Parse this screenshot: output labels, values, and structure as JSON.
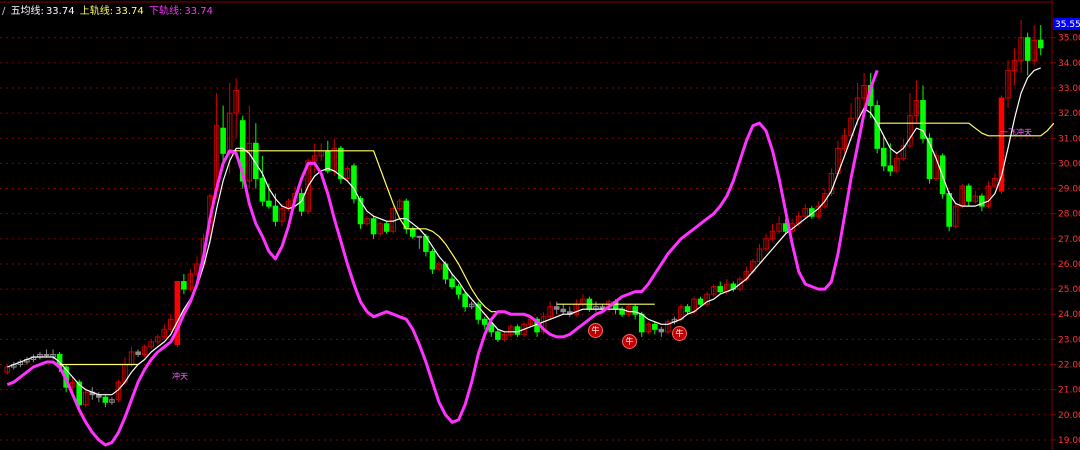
{
  "legend": {
    "prefix": "/",
    "ma_label": "五均线:",
    "ma_value": "33.74",
    "upper_label": "上轨线:",
    "upper_value": "33.74",
    "lower_label": "下轨线:",
    "lower_value": "33.74"
  },
  "price_tag": "35.55",
  "labels": {
    "chongtian": "冲天",
    "yiqichongtian": "一飞冲天",
    "niu": "牛"
  },
  "colors": {
    "up_candle": "#cc0000",
    "down_candle": "#00ff00",
    "doji_candle": "#8c8c8c",
    "limit_up": "#ff0000",
    "ma_line": "#ffffff",
    "upper_band": "#ffff66",
    "lower_band": "#ff33ff",
    "grid": "#800000",
    "axis_text": "#ff3333",
    "price_tag_bg": "#0000ff"
  },
  "chart_data": {
    "type": "candlestick",
    "title": "",
    "y_ticks": [
      19.0,
      20.0,
      21.0,
      22.0,
      23.0,
      24.0,
      25.0,
      26.0,
      27.0,
      28.0,
      29.0,
      30.0,
      31.0,
      32.0,
      33.0,
      34.0,
      35.0
    ],
    "ylim": [
      18.6,
      36.5
    ],
    "grid": true,
    "candles": [
      [
        21.7,
        21.9,
        21.6,
        22.0
      ],
      [
        21.9,
        22.0,
        21.8,
        22.1
      ],
      [
        22.0,
        22.1,
        21.9,
        22.2
      ],
      [
        22.1,
        22.2,
        22.0,
        22.3
      ],
      [
        22.2,
        22.3,
        22.1,
        22.4
      ],
      [
        22.3,
        22.4,
        22.2,
        22.5
      ],
      [
        22.4,
        22.4,
        22.3,
        22.6
      ],
      [
        22.3,
        22.4,
        22.2,
        22.6
      ],
      [
        22.4,
        21.9,
        21.7,
        22.5
      ],
      [
        21.9,
        21.1,
        20.9,
        22.0
      ],
      [
        21.1,
        21.3,
        20.9,
        21.5
      ],
      [
        21.3,
        20.4,
        20.2,
        21.4
      ],
      [
        20.4,
        20.9,
        20.3,
        21.0
      ],
      [
        20.9,
        20.8,
        20.6,
        21.1
      ],
      [
        20.8,
        20.7,
        20.5,
        20.9
      ],
      [
        20.7,
        20.5,
        20.3,
        20.8
      ],
      [
        20.5,
        20.6,
        20.4,
        20.7
      ],
      [
        20.6,
        21.3,
        20.5,
        21.4
      ],
      [
        21.3,
        22.0,
        21.2,
        22.3
      ],
      [
        22.0,
        22.5,
        21.9,
        22.7
      ],
      [
        22.5,
        22.4,
        22.3,
        22.6
      ],
      [
        22.4,
        22.7,
        22.3,
        22.8
      ],
      [
        22.7,
        22.9,
        22.6,
        23.0
      ],
      [
        22.9,
        23.1,
        22.8,
        23.2
      ],
      [
        23.1,
        23.4,
        23.0,
        23.6
      ],
      [
        23.4,
        23.8,
        23.3,
        24.0
      ],
      [
        22.8,
        25.3,
        22.7,
        25.3
      ],
      [
        25.3,
        25.0,
        24.8,
        25.6
      ],
      [
        25.0,
        25.6,
        24.9,
        25.8
      ],
      [
        25.6,
        26.0,
        25.5,
        26.3
      ],
      [
        26.0,
        27.0,
        25.9,
        27.2
      ],
      [
        27.4,
        28.7,
        26.8,
        28.8
      ],
      [
        28.9,
        31.5,
        28.6,
        32.8
      ],
      [
        31.4,
        30.4,
        29.8,
        32.3
      ],
      [
        30.4,
        32.0,
        29.6,
        33.2
      ],
      [
        32.0,
        32.9,
        31.0,
        33.4
      ],
      [
        31.7,
        29.3,
        29.0,
        31.9
      ],
      [
        29.3,
        30.8,
        29.0,
        32.3
      ],
      [
        30.8,
        29.4,
        29.0,
        31.6
      ],
      [
        29.4,
        28.5,
        28.3,
        30.3
      ],
      [
        28.5,
        28.3,
        28.2,
        29.2
      ],
      [
        28.3,
        27.7,
        27.5,
        28.8
      ],
      [
        27.7,
        28.2,
        27.5,
        28.4
      ],
      [
        28.2,
        28.5,
        28.1,
        28.6
      ],
      [
        28.5,
        28.8,
        28.2,
        29.1
      ],
      [
        28.8,
        28.1,
        27.9,
        29.0
      ],
      [
        28.1,
        30.1,
        28.0,
        30.2
      ],
      [
        30.1,
        30.3,
        29.6,
        30.8
      ],
      [
        30.3,
        30.5,
        30.1,
        30.8
      ],
      [
        30.5,
        29.7,
        29.6,
        30.9
      ],
      [
        29.7,
        30.6,
        29.5,
        31.0
      ],
      [
        30.6,
        29.4,
        29.2,
        30.7
      ],
      [
        29.4,
        29.8,
        29.3,
        29.9
      ],
      [
        29.9,
        28.6,
        28.4,
        30.0
      ],
      [
        28.6,
        27.6,
        27.4,
        28.7
      ],
      [
        27.6,
        27.8,
        27.5,
        27.9
      ],
      [
        27.8,
        27.2,
        27.0,
        27.9
      ],
      [
        27.2,
        27.6,
        27.1,
        27.7
      ],
      [
        27.6,
        27.3,
        27.2,
        27.7
      ],
      [
        27.3,
        28.2,
        27.2,
        28.3
      ],
      [
        28.2,
        28.5,
        28.1,
        28.6
      ],
      [
        28.5,
        27.4,
        27.2,
        28.6
      ],
      [
        27.4,
        27.1,
        27.0,
        27.5
      ],
      [
        27.1,
        27.1,
        26.6,
        27.1
      ],
      [
        27.1,
        26.5,
        26.3,
        27.2
      ],
      [
        26.5,
        25.8,
        25.6,
        26.6
      ],
      [
        25.8,
        26.0,
        25.7,
        26.1
      ],
      [
        26.0,
        25.4,
        25.2,
        26.1
      ],
      [
        25.4,
        25.1,
        25.0,
        25.6
      ],
      [
        25.1,
        24.8,
        24.6,
        25.2
      ],
      [
        24.8,
        24.3,
        24.1,
        24.9
      ],
      [
        24.3,
        24.4,
        24.2,
        24.5
      ],
      [
        24.4,
        23.8,
        23.6,
        24.5
      ],
      [
        23.8,
        23.6,
        23.4,
        23.9
      ],
      [
        23.6,
        23.3,
        23.1,
        23.7
      ],
      [
        23.3,
        23.0,
        22.9,
        23.4
      ],
      [
        23.0,
        23.2,
        22.9,
        23.3
      ],
      [
        23.2,
        23.5,
        23.1,
        23.6
      ],
      [
        23.5,
        23.2,
        23.1,
        23.6
      ],
      [
        23.2,
        23.6,
        23.1,
        23.7
      ],
      [
        23.6,
        23.8,
        23.5,
        23.9
      ],
      [
        23.8,
        23.3,
        23.1,
        23.9
      ],
      [
        23.3,
        23.9,
        23.2,
        24.1
      ],
      [
        23.9,
        24.3,
        23.8,
        24.5
      ],
      [
        24.3,
        24.2,
        24.0,
        24.5
      ],
      [
        24.2,
        24.1,
        24.0,
        24.4
      ],
      [
        24.1,
        24.0,
        23.9,
        24.3
      ],
      [
        24.0,
        24.4,
        23.9,
        24.6
      ],
      [
        24.4,
        24.6,
        24.3,
        24.8
      ],
      [
        24.6,
        24.2,
        24.1,
        24.7
      ],
      [
        24.2,
        24.3,
        24.1,
        24.5
      ],
      [
        24.3,
        24.2,
        24.1,
        24.4
      ],
      [
        24.2,
        24.5,
        24.1,
        24.6
      ],
      [
        24.5,
        24.2,
        24.0,
        24.6
      ],
      [
        24.2,
        24.0,
        23.9,
        24.3
      ],
      [
        24.0,
        24.3,
        23.9,
        24.4
      ],
      [
        24.3,
        24.0,
        23.8,
        24.4
      ],
      [
        24.0,
        23.3,
        23.1,
        24.1
      ],
      [
        23.3,
        23.6,
        23.2,
        23.7
      ],
      [
        23.6,
        23.4,
        23.2,
        23.7
      ],
      [
        23.4,
        23.3,
        23.1,
        23.5
      ],
      [
        23.3,
        23.7,
        23.2,
        23.8
      ],
      [
        23.7,
        23.8,
        23.6,
        23.9
      ],
      [
        23.8,
        24.3,
        23.7,
        24.4
      ],
      [
        24.3,
        24.1,
        24.0,
        24.4
      ],
      [
        24.1,
        24.6,
        24.0,
        24.7
      ],
      [
        24.6,
        24.4,
        24.3,
        24.7
      ],
      [
        24.4,
        24.8,
        24.3,
        24.9
      ],
      [
        24.8,
        25.1,
        24.7,
        25.2
      ],
      [
        25.1,
        24.9,
        24.8,
        25.3
      ],
      [
        24.9,
        25.2,
        24.8,
        25.4
      ],
      [
        25.2,
        25.0,
        24.9,
        25.3
      ],
      [
        25.0,
        25.4,
        24.9,
        25.5
      ],
      [
        25.4,
        25.7,
        25.3,
        25.9
      ],
      [
        25.7,
        26.1,
        25.6,
        26.2
      ],
      [
        26.1,
        26.6,
        26.0,
        26.8
      ],
      [
        26.6,
        27.0,
        26.5,
        27.2
      ],
      [
        27.0,
        27.3,
        26.9,
        27.6
      ],
      [
        27.3,
        27.6,
        27.2,
        27.9
      ],
      [
        27.6,
        27.3,
        27.2,
        27.8
      ],
      [
        27.3,
        27.6,
        27.2,
        27.8
      ],
      [
        27.6,
        27.9,
        27.5,
        28.1
      ],
      [
        27.9,
        28.2,
        27.8,
        28.4
      ],
      [
        28.2,
        27.9,
        27.8,
        28.3
      ],
      [
        27.9,
        28.3,
        27.8,
        28.5
      ],
      [
        28.3,
        28.8,
        28.2,
        29.0
      ],
      [
        28.8,
        29.6,
        28.7,
        29.8
      ],
      [
        29.6,
        30.6,
        29.5,
        30.9
      ],
      [
        30.6,
        31.1,
        30.4,
        31.4
      ],
      [
        31.1,
        31.8,
        30.9,
        32.4
      ],
      [
        31.8,
        32.6,
        31.5,
        33.2
      ],
      [
        32.6,
        33.1,
        32.1,
        33.6
      ],
      [
        33.1,
        32.3,
        31.8,
        33.6
      ],
      [
        32.3,
        30.6,
        30.4,
        32.5
      ],
      [
        30.6,
        29.9,
        29.7,
        31.1
      ],
      [
        29.9,
        29.7,
        29.5,
        30.8
      ],
      [
        29.7,
        30.2,
        29.6,
        30.4
      ],
      [
        30.2,
        30.7,
        30.1,
        31.0
      ],
      [
        30.7,
        31.9,
        30.6,
        32.8
      ],
      [
        31.9,
        32.5,
        31.6,
        33.3
      ],
      [
        32.5,
        31.0,
        30.8,
        33.1
      ],
      [
        31.0,
        29.4,
        29.2,
        31.2
      ],
      [
        29.4,
        30.3,
        29.3,
        30.5
      ],
      [
        30.3,
        28.8,
        28.6,
        30.4
      ],
      [
        28.8,
        27.5,
        27.3,
        28.9
      ],
      [
        27.5,
        28.3,
        27.4,
        28.4
      ],
      [
        28.3,
        29.1,
        28.2,
        29.2
      ],
      [
        29.1,
        28.5,
        28.3,
        29.2
      ],
      [
        28.5,
        28.7,
        28.4,
        28.9
      ],
      [
        28.7,
        28.3,
        28.1,
        28.8
      ],
      [
        28.3,
        29.1,
        28.2,
        29.3
      ],
      [
        29.1,
        29.4,
        29.0,
        29.6
      ],
      [
        28.9,
        32.6,
        28.8,
        32.7
      ],
      [
        32.6,
        33.7,
        32.2,
        34.1
      ],
      [
        33.7,
        34.1,
        33.1,
        34.6
      ],
      [
        34.1,
        35.0,
        33.6,
        35.7
      ],
      [
        35.0,
        34.1,
        33.5,
        35.2
      ],
      [
        34.1,
        34.9,
        33.9,
        35.5
      ],
      [
        34.9,
        34.6,
        34.3,
        35.5
      ]
    ],
    "ma_line": [
      21.9,
      22.0,
      22.1,
      22.2,
      22.3,
      22.3,
      22.3,
      22.3,
      22.1,
      21.8,
      21.5,
      21.2,
      21.0,
      20.9,
      20.8,
      20.8,
      20.8,
      21.0,
      21.3,
      21.7,
      22.0,
      22.2,
      22.5,
      22.7,
      22.9,
      23.2,
      23.7,
      24.2,
      24.6,
      25.1,
      25.9,
      26.9,
      28.2,
      29.3,
      30.1,
      30.6,
      30.6,
      30.4,
      30.0,
      29.6,
      29.0,
      28.6,
      28.3,
      28.2,
      28.3,
      28.5,
      29.1,
      29.5,
      29.7,
      29.8,
      29.7,
      29.5,
      29.3,
      29.0,
      28.5,
      28.1,
      27.9,
      27.8,
      27.7,
      27.7,
      27.8,
      27.8,
      27.6,
      27.4,
      27.1,
      26.7,
      26.3,
      26.0,
      25.6,
      25.3,
      24.9,
      24.6,
      24.3,
      24.0,
      23.7,
      23.4,
      23.3,
      23.3,
      23.3,
      23.4,
      23.5,
      23.6,
      23.7,
      23.8,
      23.9,
      24.0,
      24.0,
      24.1,
      24.2,
      24.2,
      24.2,
      24.2,
      24.2,
      24.2,
      24.2,
      24.1,
      24.1,
      24.0,
      23.8,
      23.7,
      23.6,
      23.6,
      23.7,
      23.8,
      24.0,
      24.1,
      24.3,
      24.5,
      24.6,
      24.8,
      24.9,
      25.0,
      25.2,
      25.4,
      25.7,
      26.0,
      26.3,
      26.6,
      26.9,
      27.2,
      27.4,
      27.6,
      27.8,
      28.0,
      28.2,
      28.5,
      28.9,
      29.6,
      30.3,
      31.0,
      31.7,
      32.2,
      32.0,
      31.6,
      31.1,
      30.6,
      30.4,
      30.6,
      31.0,
      31.4,
      31.3,
      30.8,
      30.2,
      29.5,
      28.8,
      28.4,
      28.3,
      28.3,
      28.3,
      28.4,
      28.5,
      28.8,
      29.5,
      30.6,
      31.8,
      32.8,
      33.4,
      33.7,
      33.8
    ],
    "upper_band": [
      null,
      null,
      null,
      null,
      null,
      null,
      null,
      null,
      22.0,
      22.0,
      22.0,
      22.0,
      22.0,
      22.0,
      22.0,
      22.0,
      22.0,
      22.0,
      22.0,
      22.0,
      22.0,
      null,
      null,
      null,
      null,
      null,
      null,
      null,
      null,
      null,
      null,
      null,
      null,
      null,
      30.5,
      30.5,
      30.5,
      30.5,
      30.5,
      30.5,
      30.5,
      30.5,
      30.5,
      30.5,
      30.5,
      30.5,
      30.5,
      30.5,
      30.5,
      30.5,
      30.5,
      30.5,
      30.5,
      30.5,
      30.5,
      30.5,
      30.5,
      29.8,
      29.1,
      28.4,
      27.8,
      27.4,
      27.4,
      27.4,
      27.4,
      27.3,
      27.1,
      26.8,
      26.4,
      26.0,
      25.5,
      25.0,
      24.6,
      24.3,
      24.1,
      24.1,
      null,
      null,
      null,
      null,
      null,
      null,
      null,
      null,
      24.4,
      24.4,
      24.4,
      24.4,
      24.4,
      24.4,
      24.4,
      24.4,
      24.4,
      24.4,
      24.4,
      24.4,
      24.4,
      24.4,
      24.4,
      24.4,
      null,
      null,
      null,
      null,
      null,
      null,
      null,
      null,
      null,
      null,
      null,
      null,
      null,
      null,
      null,
      null,
      null,
      null,
      null,
      null,
      null,
      null,
      null,
      null,
      null,
      null,
      null,
      null,
      null,
      null,
      null,
      null,
      null,
      31.6,
      31.6,
      31.6,
      31.6,
      31.6,
      31.6,
      31.6,
      31.6,
      31.6,
      31.6,
      31.6,
      31.6,
      31.6,
      31.6,
      31.6,
      31.4,
      31.2,
      31.1,
      31.1,
      31.1,
      31.1,
      31.1,
      31.1,
      31.1,
      31.1,
      31.1,
      31.3,
      31.6,
      null,
      null,
      null
    ],
    "lower_band": [
      21.2,
      21.3,
      21.5,
      21.7,
      21.9,
      22.0,
      22.1,
      22.1,
      21.9,
      21.4,
      20.8,
      20.2,
      19.7,
      19.3,
      19.0,
      18.8,
      18.9,
      19.3,
      19.9,
      20.6,
      21.3,
      21.8,
      22.2,
      22.5,
      22.7,
      22.9,
      23.4,
      24.0,
      24.5,
      25.2,
      26.3,
      27.8,
      29.0,
      30.0,
      30.5,
      30.4,
      29.6,
      28.4,
      27.6,
      27.1,
      26.5,
      26.2,
      26.7,
      27.5,
      28.6,
      29.4,
      30.0,
      30.0,
      29.6,
      28.8,
      27.8,
      26.9,
      26.0,
      25.2,
      24.5,
      24.1,
      23.9,
      24.0,
      24.1,
      24.0,
      23.9,
      23.8,
      23.4,
      22.8,
      22.1,
      21.3,
      20.5,
      20.0,
      19.7,
      19.8,
      20.4,
      21.3,
      22.4,
      23.2,
      23.8,
      24.1,
      24.1,
      24.0,
      24.0,
      24.0,
      23.9,
      23.7,
      23.4,
      23.2,
      23.1,
      23.1,
      23.2,
      23.4,
      23.6,
      23.8,
      24.0,
      24.1,
      24.3,
      24.5,
      24.7,
      24.8,
      24.9,
      24.9,
      25.2,
      25.6,
      26.0,
      26.4,
      26.7,
      27.0,
      27.2,
      27.4,
      27.6,
      27.8,
      28.0,
      28.3,
      28.7,
      29.3,
      30.1,
      30.9,
      31.5,
      31.6,
      31.3,
      30.5,
      29.4,
      28.1,
      26.8,
      25.7,
      25.2,
      25.1,
      25.0,
      25.0,
      25.3,
      26.4,
      27.9,
      29.4,
      30.7,
      32.0,
      33.0,
      33.7
    ]
  }
}
